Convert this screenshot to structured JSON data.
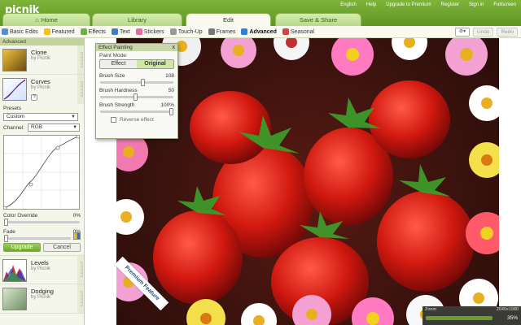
{
  "app": {
    "logo": "picnik"
  },
  "top_menu": {
    "language": "English",
    "help": "Help",
    "upgrade": "Upgrade to Premium",
    "register": "Register",
    "sign_in": "Sign in",
    "fullscreen": "Fullscreen"
  },
  "tabs": [
    {
      "label": "Home",
      "active": false
    },
    {
      "label": "Library",
      "active": false
    },
    {
      "label": "Edit",
      "active": true
    },
    {
      "label": "Save & Share",
      "active": false
    }
  ],
  "toolbar": {
    "items": [
      {
        "label": "Basic Edits",
        "icon": "wand-icon",
        "color": "#5b8bd1"
      },
      {
        "label": "Featured",
        "icon": "star-icon",
        "color": "#f3c11b"
      },
      {
        "label": "Effects",
        "icon": "effects-icon",
        "color": "#6ab04c"
      },
      {
        "label": "Text",
        "icon": "text-icon",
        "color": "#3f7fbf"
      },
      {
        "label": "Stickers",
        "icon": "sticker-icon",
        "color": "#e36ea3"
      },
      {
        "label": "Touch-Up",
        "icon": "brush-icon",
        "color": "#999999"
      },
      {
        "label": "Frames",
        "icon": "frame-icon",
        "color": "#777777"
      },
      {
        "label": "Advanced",
        "icon": "gear-icon",
        "color": "#2f7fd8"
      },
      {
        "label": "Seasonal",
        "icon": "calendar-icon",
        "color": "#d24545"
      }
    ],
    "active": "Advanced",
    "undo": "Undo",
    "redo": "Redo"
  },
  "left_panel": {
    "section": "Advanced",
    "effects_top": [
      {
        "name": "Clone",
        "by": "by Picnik"
      },
      {
        "name": "Curves",
        "by": "by Picnik"
      }
    ],
    "help_label": "?",
    "presets_label": "Presets",
    "presets_value": "Custom",
    "channel_label": "Channel:",
    "channel_value": "RGB",
    "color_override_label": "Color Override",
    "color_override_value": "0%",
    "color_override_level": 0,
    "fade_label": "Fade",
    "fade_value": "0%",
    "fade_level": 0,
    "upgrade_button": "Upgrade",
    "cancel_button": "Cancel",
    "premium_label": "premium",
    "effects_bottom": [
      {
        "name": "Levels",
        "by": "by Picnik"
      },
      {
        "name": "Dodging",
        "by": "by Picnik"
      }
    ]
  },
  "dialog": {
    "title": "Effect Painting",
    "close": "x",
    "paint_mode_label": "Paint Mode:",
    "mode_effect": "Effect",
    "mode_original": "Original",
    "selected_mode": "Original",
    "brush_size_label": "Brush Size",
    "brush_size": "108",
    "brush_hardness_label": "Brush Hardness",
    "brush_hardness": "50",
    "brush_strength_label": "Brush Strength",
    "brush_strength": "100%",
    "reverse_label": "Reverse effect"
  },
  "canvas": {
    "ribbon": "Premium Feature"
  },
  "zoom": {
    "label": "Zoom",
    "dimensions": "2640x1980",
    "value": "35%"
  }
}
